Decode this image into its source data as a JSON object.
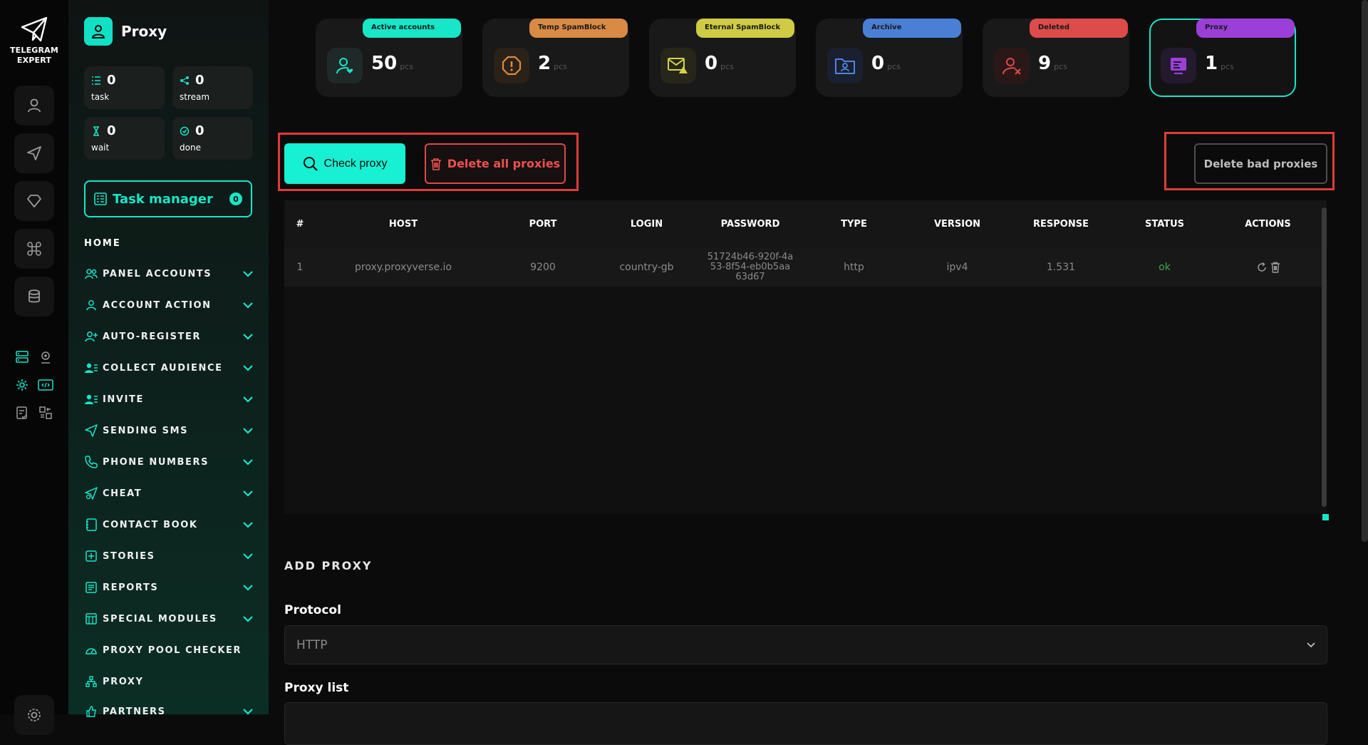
{
  "brand": {
    "line1": "TELEGRAM",
    "line2": "EXPERT"
  },
  "page": {
    "title": "Proxy"
  },
  "stats": [
    {
      "value": "0",
      "label": "task"
    },
    {
      "value": "0",
      "label": "stream"
    },
    {
      "value": "0",
      "label": "wait"
    },
    {
      "value": "0",
      "label": "done"
    }
  ],
  "task_manager": {
    "label": "Task manager",
    "count": "0"
  },
  "home_label": "HOME",
  "nav": [
    {
      "label": "PANEL ACCOUNTS",
      "icon": "users-icon"
    },
    {
      "label": "ACCOUNT ACTION",
      "icon": "user-icon"
    },
    {
      "label": "AUTO-REGISTER",
      "icon": "user-plus-icon"
    },
    {
      "label": "COLLECT AUDIENCE",
      "icon": "user-list-icon"
    },
    {
      "label": "INVITE",
      "icon": "user-list-icon"
    },
    {
      "label": "SENDING SMS",
      "icon": "send-icon"
    },
    {
      "label": "PHONE NUMBERS",
      "icon": "phone-icon"
    },
    {
      "label": "CHEAT",
      "icon": "send-gear-icon"
    },
    {
      "label": "CONTACT BOOK",
      "icon": "book-icon"
    },
    {
      "label": "STORIES",
      "icon": "plus-square-icon"
    },
    {
      "label": "REPORTS",
      "icon": "report-icon"
    },
    {
      "label": "SPECIAL MODULES",
      "icon": "table-icon"
    },
    {
      "label": "PROXY POOL CHECKER",
      "icon": "gauge-icon"
    },
    {
      "label": "PROXY",
      "icon": "network-icon"
    },
    {
      "label": "PARTNERS",
      "icon": "thumb-icon"
    }
  ],
  "categories": [
    {
      "label": "Active accounts",
      "value": "50",
      "unit": "pcs",
      "color": "#17e6c8"
    },
    {
      "label": "Temp SpamBlock",
      "value": "2",
      "unit": "pcs",
      "color": "#d98a45"
    },
    {
      "label": "Eternal SpamBlock",
      "value": "0",
      "unit": "pcs",
      "color": "#cfcb45"
    },
    {
      "label": "Archive",
      "value": "0",
      "unit": "pcs",
      "color": "#4a7fd6"
    },
    {
      "label": "Deleted",
      "value": "9",
      "unit": "pcs",
      "color": "#dd4b4b"
    },
    {
      "label": "Proxy",
      "value": "1",
      "unit": "pcs",
      "color": "#9b3fd8"
    }
  ],
  "toolbar": {
    "check_label": "Check proxy",
    "delete_all_label": "Delete all proxies",
    "delete_bad_label": "Delete bad proxies"
  },
  "table": {
    "columns": [
      "#",
      "HOST",
      "PORT",
      "LOGIN",
      "PASSWORD",
      "TYPE",
      "VERSION",
      "RESPONSE",
      "STATUS",
      "ACTIONS"
    ],
    "rows": [
      {
        "num": "1",
        "host": "proxy.proxyverse.io",
        "port": "9200",
        "login": "country-gb",
        "password": "51724b46-920f-4a53-8f54-eb0b5aa63d67",
        "password_l1": "51724b46-920f-4a",
        "password_l2": "53-8f54-eb0b5aa",
        "password_l3": "63d67",
        "type": "http",
        "version": "ipv4",
        "response": "1.531",
        "status": "ok"
      }
    ]
  },
  "add_proxy": {
    "title": "ADD PROXY",
    "protocol_label": "Protocol",
    "protocol_value": "HTTP",
    "list_label": "Proxy list"
  },
  "colors": {
    "accent": "#17e6c8",
    "danger": "#e23a3a",
    "ok": "#3aa84a"
  }
}
